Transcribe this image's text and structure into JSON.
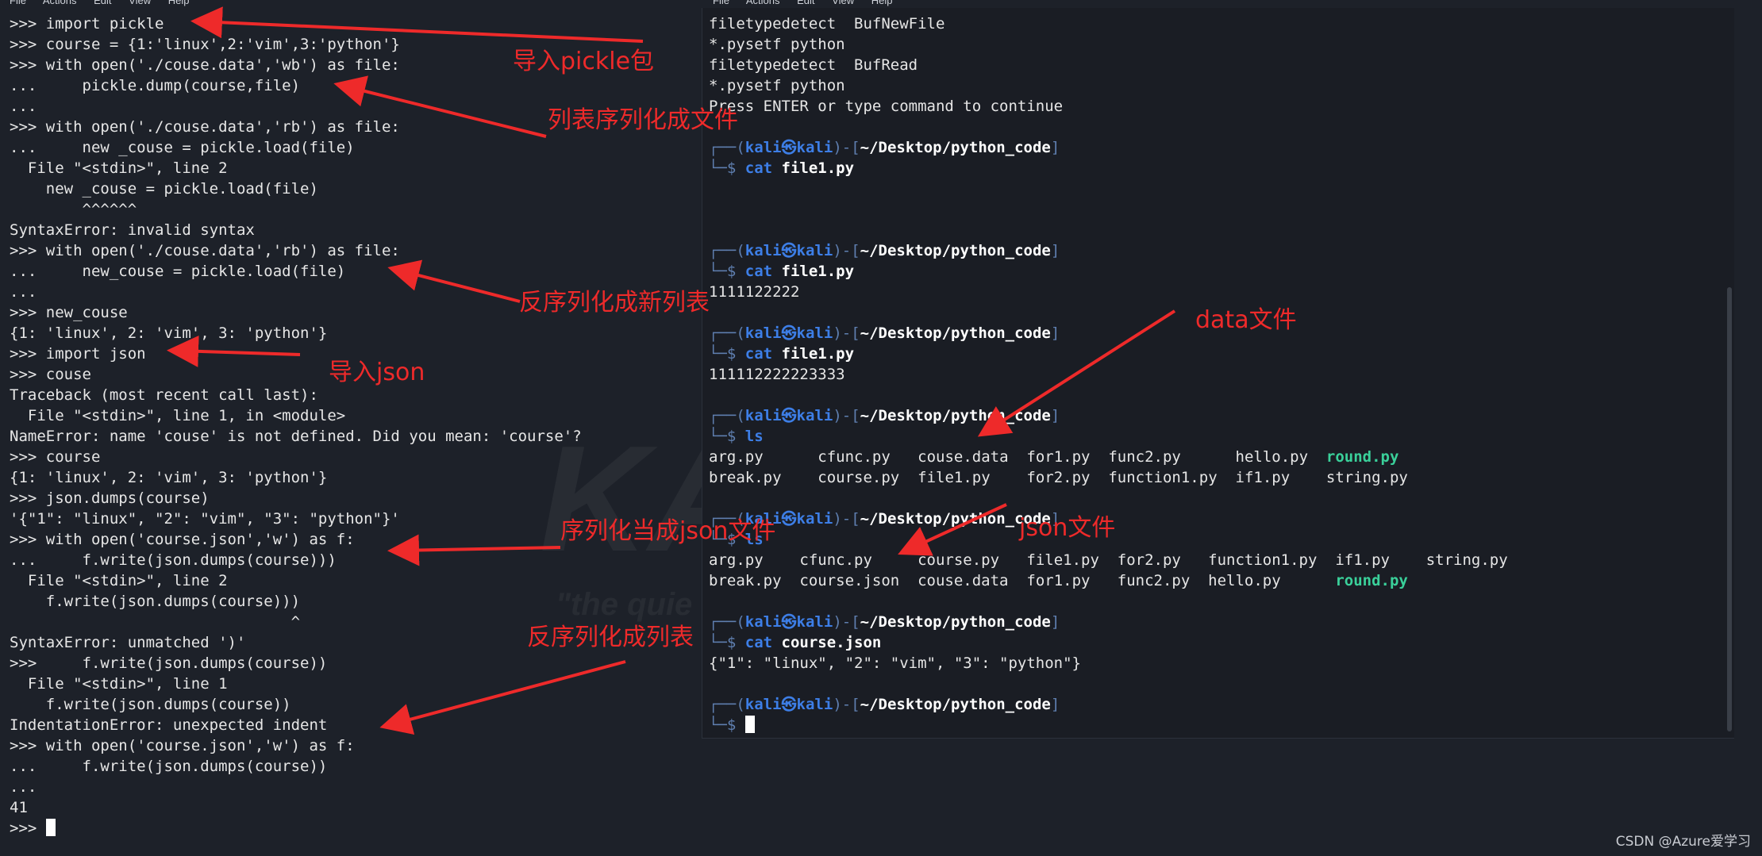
{
  "left_menu": [
    "File",
    "Actions",
    "Edit",
    "View",
    "Help"
  ],
  "right_menu": [
    "File",
    "Actions",
    "Edit",
    "View",
    "Help"
  ],
  "left_terminal": {
    "lines": [
      ">>> import pickle",
      ">>> course = {1:'linux',2:'vim',3:'python'}",
      ">>> with open('./couse.data','wb') as file:",
      "...     pickle.dump(course,file)",
      "...",
      ">>> with open('./couse.data','rb') as file:",
      "...     new _couse = pickle.load(file)",
      "  File \"<stdin>\", line 2",
      "    new _couse = pickle.load(file)",
      "        ^^^^^^",
      "SyntaxError: invalid syntax",
      ">>> with open('./couse.data','rb') as file:",
      "...     new_couse = pickle.load(file)",
      "...",
      ">>> new_couse",
      "{1: 'linux', 2: 'vim', 3: 'python'}",
      ">>> import json",
      ">>> couse",
      "Traceback (most recent call last):",
      "  File \"<stdin>\", line 1, in <module>",
      "NameError: name 'couse' is not defined. Did you mean: 'course'?",
      ">>> course",
      "{1: 'linux', 2: 'vim', 3: 'python'}",
      ">>> json.dumps(course)",
      "'{\"1\": \"linux\", \"2\": \"vim\", \"3\": \"python\"}'",
      ">>> with open('course.json','w') as f:",
      "...     f.write(json.dumps(course)))",
      "  File \"<stdin>\", line 2",
      "    f.write(json.dumps(course)))",
      "                               ^",
      "SyntaxError: unmatched ')'",
      ">>>     f.write(json.dumps(course))",
      "  File \"<stdin>\", line 1",
      "    f.write(json.dumps(course))",
      "IndentationError: unexpected indent",
      ">>> with open('course.json','w') as f:",
      "...     f.write(json.dumps(course))",
      "...",
      "41"
    ],
    "final_prompt": ">>> "
  },
  "right_terminal": {
    "head_lines": [
      "filetypedetect  BufNewFile",
      "*.pysetf python",
      "filetypedetect  BufRead",
      "*.pysetf python",
      "Press ENTER or type command to continue"
    ],
    "prompt_user": "kali",
    "prompt_sep": "㉿",
    "prompt_host": "kali",
    "prompt_path": "~/Desktop/python_code",
    "blocks": [
      {
        "cmd": "cat",
        "arg": "file1.py",
        "output": [
          ""
        ]
      },
      {
        "cmd": "cat",
        "arg": "file1.py",
        "output": [
          "1111122222"
        ]
      },
      {
        "cmd": "cat",
        "arg": "file1.py",
        "output": [
          "111112222223333"
        ]
      },
      {
        "cmd": "ls",
        "arg": "",
        "ls_rows": [
          [
            "arg.py",
            "cfunc.py",
            "couse.data",
            "for1.py",
            "func2.py",
            "hello.py",
            "round.py"
          ],
          [
            "break.py",
            "course.py",
            "file1.py",
            "for2.py",
            "function1.py",
            "if1.py",
            "string.py"
          ]
        ],
        "ls_pad": [
          12,
          11,
          12,
          9,
          14,
          10,
          10
        ]
      },
      {
        "cmd": "ls",
        "arg": "",
        "ls_rows": [
          [
            "arg.py",
            "cfunc.py",
            "course.py",
            "file1.py",
            "for2.py",
            "function1.py",
            "if1.py",
            "string.py"
          ],
          [
            "break.py",
            "course.json",
            "couse.data",
            "for1.py",
            "func2.py",
            "hello.py",
            "round.py",
            ""
          ]
        ],
        "ls_pad": [
          10,
          13,
          12,
          10,
          10,
          14,
          10,
          10
        ]
      },
      {
        "cmd": "cat",
        "arg": "course.json",
        "output": [
          "{\"1\": \"linux\", \"2\": \"vim\", \"3\": \"python\"}"
        ]
      }
    ]
  },
  "annotations": [
    {
      "id": "import-pickle",
      "text": "导入pickle包"
    },
    {
      "id": "list-serialize",
      "text": "列表序列化成文件"
    },
    {
      "id": "deserialize-new-list",
      "text": "反序列化成新列表"
    },
    {
      "id": "import-json",
      "text": "导入json"
    },
    {
      "id": "serialize-json",
      "text": "序列化当成json文件"
    },
    {
      "id": "deserialize-list",
      "text": "反序列化成列表"
    },
    {
      "id": "data-file",
      "text": "data文件"
    },
    {
      "id": "json-file",
      "text": "json文件"
    }
  ],
  "watermark": {
    "big": "KALI",
    "small": "\"the quie"
  },
  "credit": "CSDN @Azure爱学习",
  "colors": {
    "annotation": "#ee2a2a",
    "prompt_blue": "#3d7ee6",
    "exec_green": "#3ad09a"
  }
}
